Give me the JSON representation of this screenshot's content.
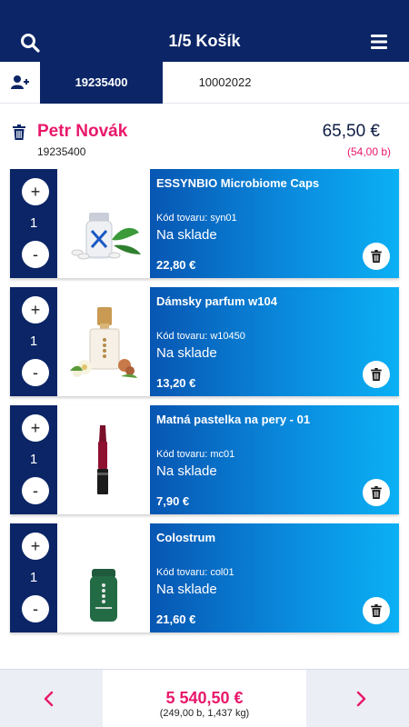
{
  "header": {
    "title": "1/5 Košík",
    "search_icon": "search-icon",
    "menu_icon": "hamburger-menu-icon",
    "background": "#0b2566"
  },
  "tabs": {
    "add_icon": "add-user-icon",
    "items": [
      {
        "label": "19235400",
        "active": true
      },
      {
        "label": "10002022",
        "active": false
      }
    ]
  },
  "customer": {
    "name": "Petr Novák",
    "id": "19235400",
    "total": "65,50 €",
    "points": "(54,00 b)",
    "accent": "#e8186b"
  },
  "items": [
    {
      "name": "ESSYNBIO Microbiome Caps",
      "code": "Kód tovaru: syn01",
      "stock": "Na sklade",
      "price": "22,80 €",
      "qty": "1",
      "image": "supplement-bottle-image"
    },
    {
      "name": "Dámsky parfum w104",
      "code": "Kód tovaru: w10450",
      "stock": "Na sklade",
      "price": "13,20 €",
      "qty": "1",
      "image": "perfume-bottle-image"
    },
    {
      "name": "Matná pastelka na pery - 01",
      "code": "Kód tovaru: mc01",
      "stock": "Na sklade",
      "price": "7,90 €",
      "qty": "1",
      "image": "lip-crayon-image"
    },
    {
      "name": "Colostrum",
      "code": "Kód tovaru: col01",
      "stock": "Na sklade",
      "price": "21,60 €",
      "qty": "1",
      "image": "colostrum-jar-image"
    }
  ],
  "controls": {
    "plus": "+",
    "minus": "-"
  },
  "footer": {
    "total": "5 540,50 €",
    "details": "(249,00 b, 1,437 kg)",
    "prev_icon": "chevron-left-icon",
    "next_icon": "chevron-right-icon"
  }
}
